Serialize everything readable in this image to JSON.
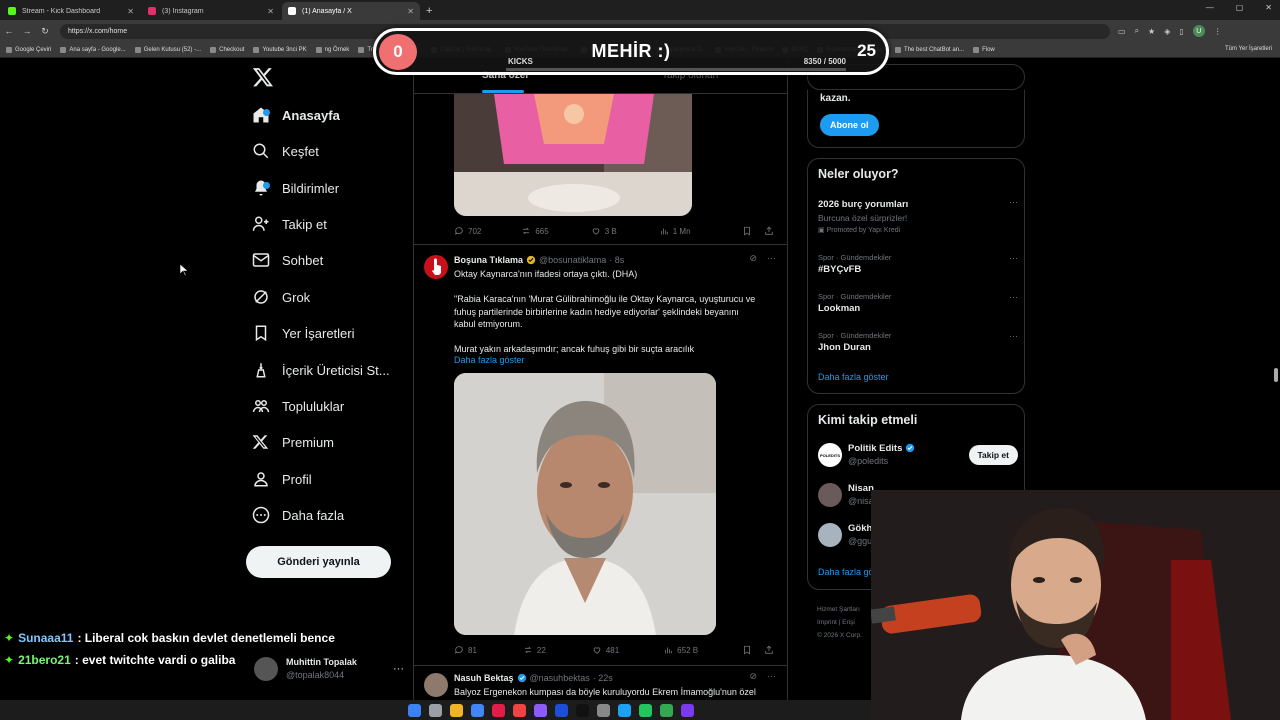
{
  "browser": {
    "tabs": [
      {
        "label": "Stream - Kick Dashboard",
        "color": "#53fc18",
        "active": false
      },
      {
        "label": "(3) Instagram",
        "color": "#e1306c",
        "active": false
      },
      {
        "label": "(1) Anasayfa / X",
        "color": "#ffffff",
        "active": true
      }
    ],
    "url": "https://x.com/home",
    "profile_initial": "U",
    "bookmarks": [
      "Google Çeviri",
      "Ana sayfa - Google...",
      "Gelen Kutusu (52) -...",
      "Checkout",
      "Youtube 3nci PK",
      "ng Örnek",
      "Transcript of \"Mi M...",
      "CapCut | Text to sp...",
      "YouTube Thumbnail...",
      "Resize and reduce i...",
      "İspanyolca Ö...",
      "HeyGen - Projects",
      "BURÇ",
      "Esperanza000 Strea...",
      "The best ChatBot an...",
      "Flow"
    ],
    "bookmarks_right": "Tüm Yer İşaretleri"
  },
  "nav": {
    "items": [
      {
        "label": "Anasayfa",
        "icon": "home-icon"
      },
      {
        "label": "Keşfet",
        "icon": "search-icon"
      },
      {
        "label": "Bildirimler",
        "icon": "bell-icon"
      },
      {
        "label": "Takip et",
        "icon": "person-add-icon"
      },
      {
        "label": "Sohbet",
        "icon": "mail-icon"
      },
      {
        "label": "Grok",
        "icon": "grok-icon"
      },
      {
        "label": "Yer İşaretleri",
        "icon": "bookmark-icon"
      },
      {
        "label": "İçerik Üreticisi St...",
        "icon": "creator-icon"
      },
      {
        "label": "Topluluklar",
        "icon": "communities-icon"
      },
      {
        "label": "Premium",
        "icon": "x-premium-icon"
      },
      {
        "label": "Profil",
        "icon": "profile-icon"
      },
      {
        "label": "Daha fazla",
        "icon": "more-circle-icon"
      }
    ],
    "post_button": "Gönderi yayınla"
  },
  "chat": [
    {
      "user": "Sunaaa11",
      "message": ": Liberal cok baskın devlet denetlemeli bence"
    },
    {
      "user": "21bero21",
      "message": ": evet twitchte vardi o galiba"
    }
  ],
  "account": {
    "name": "Muhittin Topalak",
    "handle": "@topalak8044",
    "more": "···"
  },
  "timeline": {
    "tabs": [
      "Sana özel",
      "Takip olunan"
    ],
    "post1_actions": {
      "replies": "702",
      "reposts": "665",
      "likes": "3 B",
      "views": "1 Mn"
    },
    "post2": {
      "name": "Boşuna Tıklama",
      "handle": "@bosunatiklama",
      "time": "· 8s",
      "lines": [
        "Oktay Kaynarca'nın ifadesi ortaya çıktı. (DHA)",
        "",
        "\"Rabia Karaca'nın 'Murat Gülibrahimoğlu ile Oktay Kaynarca, uyuşturucu ve",
        "fuhuş partilerinde birbirlerine kadın hediye ediyorlar' şeklindeki beyanını",
        "kabul etmiyorum.",
        "",
        "Murat yakın arkadaşımdır; ancak fuhuş gibi bir suçta aracılık"
      ],
      "show_more": "Daha fazla göster",
      "actions": {
        "replies": "81",
        "reposts": "22",
        "likes": "481",
        "views": "652 B"
      }
    },
    "post3": {
      "name": "Nasuh Bektaş",
      "handle": "@nasuhbektas",
      "time": "· 22s",
      "text": "Balyoz Ergenekon kumpası da böyle kuruluyordu Ekrem İmamoğlu'nun özel"
    }
  },
  "sidebar": {
    "premium_text": "kazan.",
    "subscribe": "Abone ol",
    "trends_title": "Neler oluyor?",
    "trends": [
      {
        "meta": "",
        "name": "2026 burç yorumları",
        "desc": "Burcuna özel sürprizler!",
        "promo": "Promoted by Yapı Kredi"
      },
      {
        "meta": "Spor · Gündemdekiler",
        "name": "#BYÇvFB",
        "desc": "",
        "promo": ""
      },
      {
        "meta": "Spor · Gündemdekiler",
        "name": "Lookman",
        "desc": "",
        "promo": ""
      },
      {
        "meta": "Spor · Gündemdekiler",
        "name": "Jhon Duran",
        "desc": "",
        "promo": ""
      }
    ],
    "show_more": "Daha fazla göster",
    "who_title": "Kimi takip etmeli",
    "who": [
      {
        "name": "Politik Edits",
        "handle": "@poledits",
        "button": "Takip et"
      },
      {
        "name": "Nisan",
        "handle": "@nisa",
        "button": ""
      },
      {
        "name": "Gökh",
        "handle": "@ggu",
        "button": ""
      }
    ],
    "who_more": "Daha fazla gö",
    "footer": [
      "Hizmet Şartları",
      "Imprint  |  Erişi",
      "© 2026 X Corp."
    ]
  },
  "kicks": {
    "left_count": "0",
    "title": "MEHİR :)",
    "label": "KICKS",
    "progress_text": "8350  / 5000",
    "right_count": "25"
  }
}
